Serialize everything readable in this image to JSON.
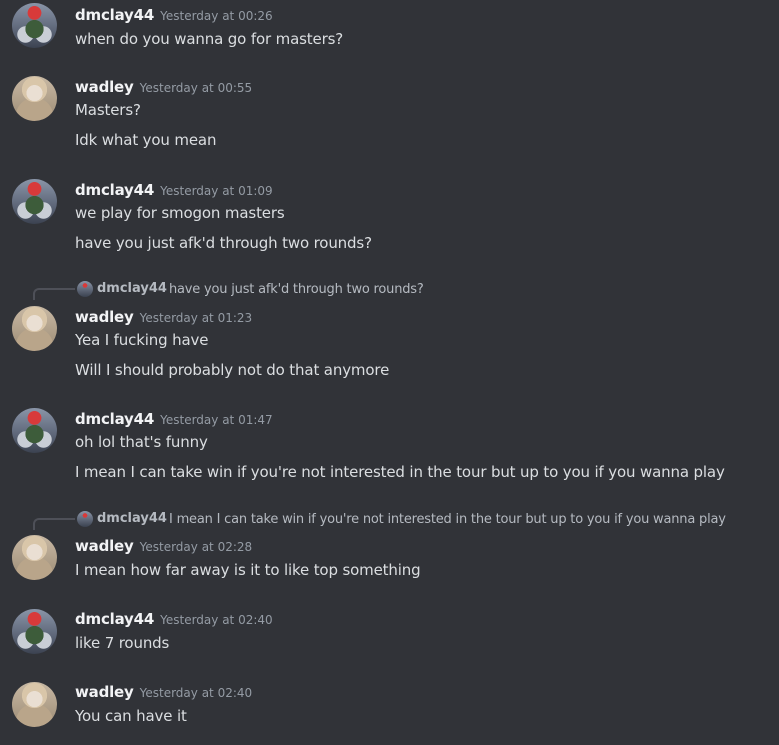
{
  "messages": [
    {
      "author": "dmclay44",
      "avatar": "dmclay44-avatar",
      "timestamp": "Yesterday at 00:26",
      "lines": [
        "when do you wanna go for masters?"
      ]
    },
    {
      "author": "wadley",
      "avatar": "wadley-avatar",
      "timestamp": "Yesterday at 00:55",
      "lines": [
        "Masters?",
        "Idk what you mean"
      ]
    },
    {
      "author": "dmclay44",
      "avatar": "dmclay44-avatar",
      "timestamp": "Yesterday at 01:09",
      "lines": [
        "we play for smogon masters",
        "have you just afk'd through two rounds?"
      ]
    },
    {
      "reply": {
        "author": "dmclay44",
        "text": "have you just afk'd through two rounds?"
      },
      "author": "wadley",
      "avatar": "wadley-avatar",
      "timestamp": "Yesterday at 01:23",
      "lines": [
        "Yea I fucking have",
        "Will I should probably not do that anymore"
      ]
    },
    {
      "author": "dmclay44",
      "avatar": "dmclay44-avatar",
      "timestamp": "Yesterday at 01:47",
      "lines": [
        "oh lol that's funny",
        "I mean I can take win if you're not interested in the tour but up to you if you wanna play"
      ]
    },
    {
      "reply": {
        "author": "dmclay44",
        "text": "I mean I can take win if you're not interested in the tour but up to you if you wanna play"
      },
      "author": "wadley",
      "avatar": "wadley-avatar",
      "timestamp": "Yesterday at 02:28",
      "lines": [
        "I mean how far away is it to like top something"
      ]
    },
    {
      "author": "dmclay44",
      "avatar": "dmclay44-avatar",
      "timestamp": "Yesterday at 02:40",
      "lines": [
        "like 7 rounds"
      ]
    },
    {
      "author": "wadley",
      "avatar": "wadley-avatar",
      "timestamp": "Yesterday at 02:40",
      "lines": [
        "You can have it"
      ]
    }
  ]
}
